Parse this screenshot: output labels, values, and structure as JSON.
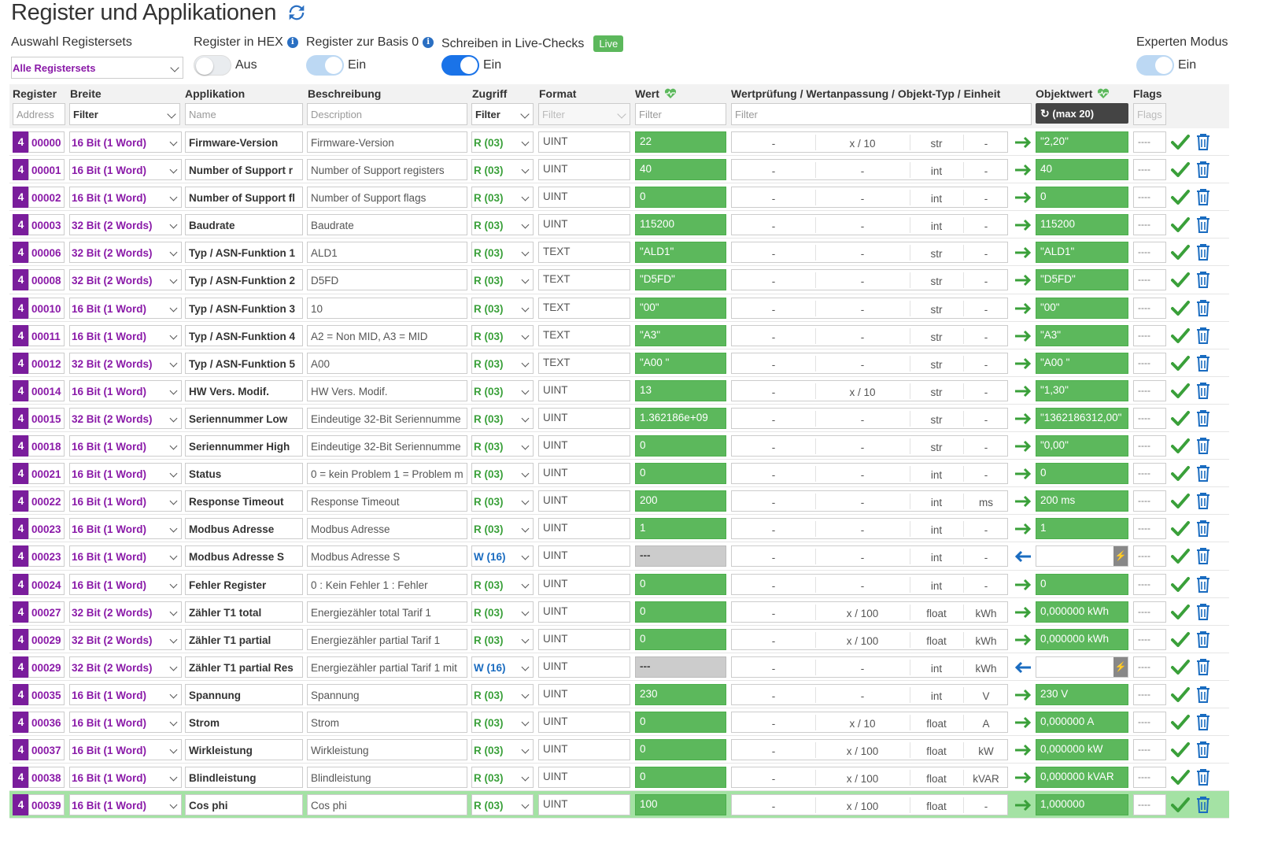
{
  "page_title": "Register und Applikationen",
  "controls": {
    "registersets_label": "Auswahl Registersets",
    "registersets_value": "Alle Registersets",
    "hex_label": "Register in HEX",
    "hex_state": "Aus",
    "basis_label": "Register zur Basis 0",
    "basis_state": "Ein",
    "live_label": "Schreiben in Live-Checks",
    "live_badge": "Live",
    "live_state": "Ein",
    "expert_label": "Experten Modus",
    "expert_state": "Ein"
  },
  "columns": {
    "register": "Register",
    "breite": "Breite",
    "applikation": "Applikation",
    "beschreibung": "Beschreibung",
    "zugriff": "Zugriff",
    "format": "Format",
    "wert": "Wert",
    "wertpruefung": "Wertprüfung / Wertanpassung / Objekt-Typ / Einheit",
    "objektwert": "Objektwert",
    "flags": "Flags"
  },
  "filters": {
    "address": "Address",
    "breite": "Filter",
    "name": "Name",
    "description": "Description",
    "zugriff": "Filter",
    "format": "Filter",
    "wert": "Filter",
    "wertpruefung": "Filter",
    "objektwert_button": "(max 20)",
    "flags": "Flags"
  },
  "colors": {
    "purple": "#7a1d9c",
    "green": "#5cb85c",
    "blue": "#1a6cc0"
  },
  "rows": [
    {
      "badge": "4",
      "address": "00000",
      "width": "16 Bit (1 Word)",
      "app": "Firmware-Version",
      "desc": "Firmware-Version",
      "access": "R (03)",
      "format": "UINT",
      "value": "22",
      "check": "-",
      "adjust": "x / 10",
      "type": "str",
      "unit": "-",
      "dir": "right",
      "object": "\"2,20\"",
      "flags": "----"
    },
    {
      "badge": "4",
      "address": "00001",
      "width": "16 Bit (1 Word)",
      "app": "Number of Support r",
      "desc": "Number of Support registers",
      "access": "R (03)",
      "format": "UINT",
      "value": "40",
      "check": "-",
      "adjust": "-",
      "type": "int",
      "unit": "-",
      "dir": "right",
      "object": "40",
      "flags": "----"
    },
    {
      "badge": "4",
      "address": "00002",
      "width": "16 Bit (1 Word)",
      "app": "Number of Support fl",
      "desc": "Number of Support flags",
      "access": "R (03)",
      "format": "UINT",
      "value": "0",
      "check": "-",
      "adjust": "-",
      "type": "int",
      "unit": "-",
      "dir": "right",
      "object": "0",
      "flags": "----"
    },
    {
      "badge": "4",
      "address": "00003",
      "width": "32 Bit (2 Words)",
      "app": "Baudrate",
      "desc": "Baudrate",
      "access": "R (03)",
      "format": "UINT",
      "value": "115200",
      "check": "-",
      "adjust": "-",
      "type": "int",
      "unit": "-",
      "dir": "right",
      "object": "115200",
      "flags": "----"
    },
    {
      "badge": "4",
      "address": "00006",
      "width": "32 Bit (2 Words)",
      "app": "Typ / ASN-Funktion 1",
      "desc": "ALD1",
      "access": "R (03)",
      "format": "TEXT",
      "value": "\"ALD1\"",
      "check": "-",
      "adjust": "-",
      "type": "str",
      "unit": "-",
      "dir": "right",
      "object": "\"ALD1\"",
      "flags": "----"
    },
    {
      "badge": "4",
      "address": "00008",
      "width": "32 Bit (2 Words)",
      "app": "Typ / ASN-Funktion 2",
      "desc": "D5FD",
      "access": "R (03)",
      "format": "TEXT",
      "value": "\"D5FD\"",
      "check": "-",
      "adjust": "-",
      "type": "str",
      "unit": "-",
      "dir": "right",
      "object": "\"D5FD\"",
      "flags": "----"
    },
    {
      "badge": "4",
      "address": "00010",
      "width": "16 Bit (1 Word)",
      "app": "Typ / ASN-Funktion 3",
      "desc": "10",
      "access": "R (03)",
      "format": "TEXT",
      "value": "\"00\"",
      "check": "-",
      "adjust": "-",
      "type": "str",
      "unit": "-",
      "dir": "right",
      "object": "\"00\"",
      "flags": "----"
    },
    {
      "badge": "4",
      "address": "00011",
      "width": "16 Bit (1 Word)",
      "app": "Typ / ASN-Funktion 4",
      "desc": "A2 = Non MID,  A3 = MID",
      "access": "R (03)",
      "format": "TEXT",
      "value": "\"A3\"",
      "check": "-",
      "adjust": "-",
      "type": "str",
      "unit": "-",
      "dir": "right",
      "object": "\"A3\"",
      "flags": "----"
    },
    {
      "badge": "4",
      "address": "00012",
      "width": "32 Bit (2 Words)",
      "app": "Typ / ASN-Funktion 5",
      "desc": "A00",
      "access": "R (03)",
      "format": "TEXT",
      "value": "\"A00 \"",
      "check": "-",
      "adjust": "-",
      "type": "str",
      "unit": "-",
      "dir": "right",
      "object": "\"A00 \"",
      "flags": "----"
    },
    {
      "badge": "4",
      "address": "00014",
      "width": "16 Bit (1 Word)",
      "app": "HW Vers. Modif.",
      "desc": "HW Vers. Modif.",
      "access": "R (03)",
      "format": "UINT",
      "value": "13",
      "check": "-",
      "adjust": "x / 10",
      "type": "str",
      "unit": "-",
      "dir": "right",
      "object": "\"1,30\"",
      "flags": "----"
    },
    {
      "badge": "4",
      "address": "00015",
      "width": "32 Bit (2 Words)",
      "app": "Seriennummer Low",
      "desc": "Eindeutige 32-Bit Seriennumme",
      "access": "R (03)",
      "format": "UINT",
      "value": "1.362186e+09",
      "check": "-",
      "adjust": "-",
      "type": "str",
      "unit": "-",
      "dir": "right",
      "object": "\"1362186312,00\"",
      "flags": "----"
    },
    {
      "badge": "4",
      "address": "00018",
      "width": "16 Bit (1 Word)",
      "app": "Seriennummer High",
      "desc": "Eindeutige 32-Bit Seriennumme",
      "access": "R (03)",
      "format": "UINT",
      "value": "0",
      "check": "-",
      "adjust": "-",
      "type": "str",
      "unit": "-",
      "dir": "right",
      "object": "\"0,00\"",
      "flags": "----"
    },
    {
      "badge": "4",
      "address": "00021",
      "width": "16 Bit (1 Word)",
      "app": "Status",
      "desc": "0 = kein Problem 1 = Problem m",
      "access": "R (03)",
      "format": "UINT",
      "value": "0",
      "check": "-",
      "adjust": "-",
      "type": "int",
      "unit": "-",
      "dir": "right",
      "object": "0",
      "flags": "----"
    },
    {
      "badge": "4",
      "address": "00022",
      "width": "16 Bit (1 Word)",
      "app": "Response Timeout",
      "desc": "Response Timeout",
      "access": "R (03)",
      "format": "UINT",
      "value": "200",
      "check": "-",
      "adjust": "-",
      "type": "int",
      "unit": "ms",
      "dir": "right",
      "object": "200 ms",
      "flags": "----"
    },
    {
      "badge": "4",
      "address": "00023",
      "width": "16 Bit (1 Word)",
      "app": "Modbus Adresse",
      "desc": "Modbus Adresse",
      "access": "R (03)",
      "format": "UINT",
      "value": "1",
      "check": "-",
      "adjust": "-",
      "type": "int",
      "unit": "-",
      "dir": "right",
      "object": "1",
      "flags": "----"
    },
    {
      "badge": "4",
      "address": "00023",
      "width": "16 Bit (1 Word)",
      "app": "Modbus Adresse S",
      "desc": "Modbus Adresse S",
      "access": "W (16)",
      "format": "UINT",
      "value": "---",
      "check": "-",
      "adjust": "-",
      "type": "int",
      "unit": "-",
      "dir": "left",
      "object": "",
      "flags": "----"
    },
    {
      "badge": "4",
      "address": "00024",
      "width": "16 Bit (1 Word)",
      "app": "Fehler Register",
      "desc": "0 : Kein Fehler 1 : Fehler",
      "access": "R (03)",
      "format": "UINT",
      "value": "0",
      "check": "-",
      "adjust": "-",
      "type": "int",
      "unit": "-",
      "dir": "right",
      "object": "0",
      "flags": "----"
    },
    {
      "badge": "4",
      "address": "00027",
      "width": "32 Bit (2 Words)",
      "app": "Zähler T1 total",
      "desc": "Energiezähler total Tarif 1",
      "access": "R (03)",
      "format": "UINT",
      "value": "0",
      "check": "-",
      "adjust": "x / 100",
      "type": "float",
      "unit": "kWh",
      "dir": "right",
      "object": "0,000000 kWh",
      "flags": "----"
    },
    {
      "badge": "4",
      "address": "00029",
      "width": "32 Bit (2 Words)",
      "app": "Zähler T1 partial",
      "desc": "Energiezähler partial Tarif 1",
      "access": "R (03)",
      "format": "UINT",
      "value": "0",
      "check": "-",
      "adjust": "x / 100",
      "type": "float",
      "unit": "kWh",
      "dir": "right",
      "object": "0,000000 kWh",
      "flags": "----"
    },
    {
      "badge": "4",
      "address": "00029",
      "width": "32 Bit (2 Words)",
      "app": "Zähler T1 partial Res",
      "desc": "Energiezähler partial Tarif 1 mit",
      "access": "W (16)",
      "format": "UINT",
      "value": "---",
      "check": "-",
      "adjust": "-",
      "type": "int",
      "unit": "kWh",
      "dir": "left",
      "object": "",
      "flags": "----"
    },
    {
      "badge": "4",
      "address": "00035",
      "width": "16 Bit (1 Word)",
      "app": "Spannung",
      "desc": "Spannung",
      "access": "R (03)",
      "format": "UINT",
      "value": "230",
      "check": "-",
      "adjust": "-",
      "type": "int",
      "unit": "V",
      "dir": "right",
      "object": "230 V",
      "flags": "----"
    },
    {
      "badge": "4",
      "address": "00036",
      "width": "16 Bit (1 Word)",
      "app": "Strom",
      "desc": "Strom",
      "access": "R (03)",
      "format": "UINT",
      "value": "0",
      "check": "-",
      "adjust": "x / 10",
      "type": "float",
      "unit": "A",
      "dir": "right",
      "object": "0,000000 A",
      "flags": "----"
    },
    {
      "badge": "4",
      "address": "00037",
      "width": "16 Bit (1 Word)",
      "app": "Wirkleistung",
      "desc": "Wirkleistung",
      "access": "R (03)",
      "format": "UINT",
      "value": "0",
      "check": "-",
      "adjust": "x / 100",
      "type": "float",
      "unit": "kW",
      "dir": "right",
      "object": "0,000000 kW",
      "flags": "----"
    },
    {
      "badge": "4",
      "address": "00038",
      "width": "16 Bit (1 Word)",
      "app": "Blindleistung",
      "desc": "Blindleistung",
      "access": "R (03)",
      "format": "UINT",
      "value": "0",
      "check": "-",
      "adjust": "x / 100",
      "type": "float",
      "unit": "kVAR",
      "dir": "right",
      "object": "0,000000 kVAR",
      "flags": "----"
    },
    {
      "badge": "4",
      "address": "00039",
      "width": "16 Bit (1 Word)",
      "app": "Cos phi",
      "desc": "Cos phi",
      "access": "R (03)",
      "format": "UINT",
      "value": "100",
      "check": "-",
      "adjust": "x / 100",
      "type": "float",
      "unit": "-",
      "dir": "right",
      "object": "1,000000",
      "flags": "----"
    }
  ]
}
